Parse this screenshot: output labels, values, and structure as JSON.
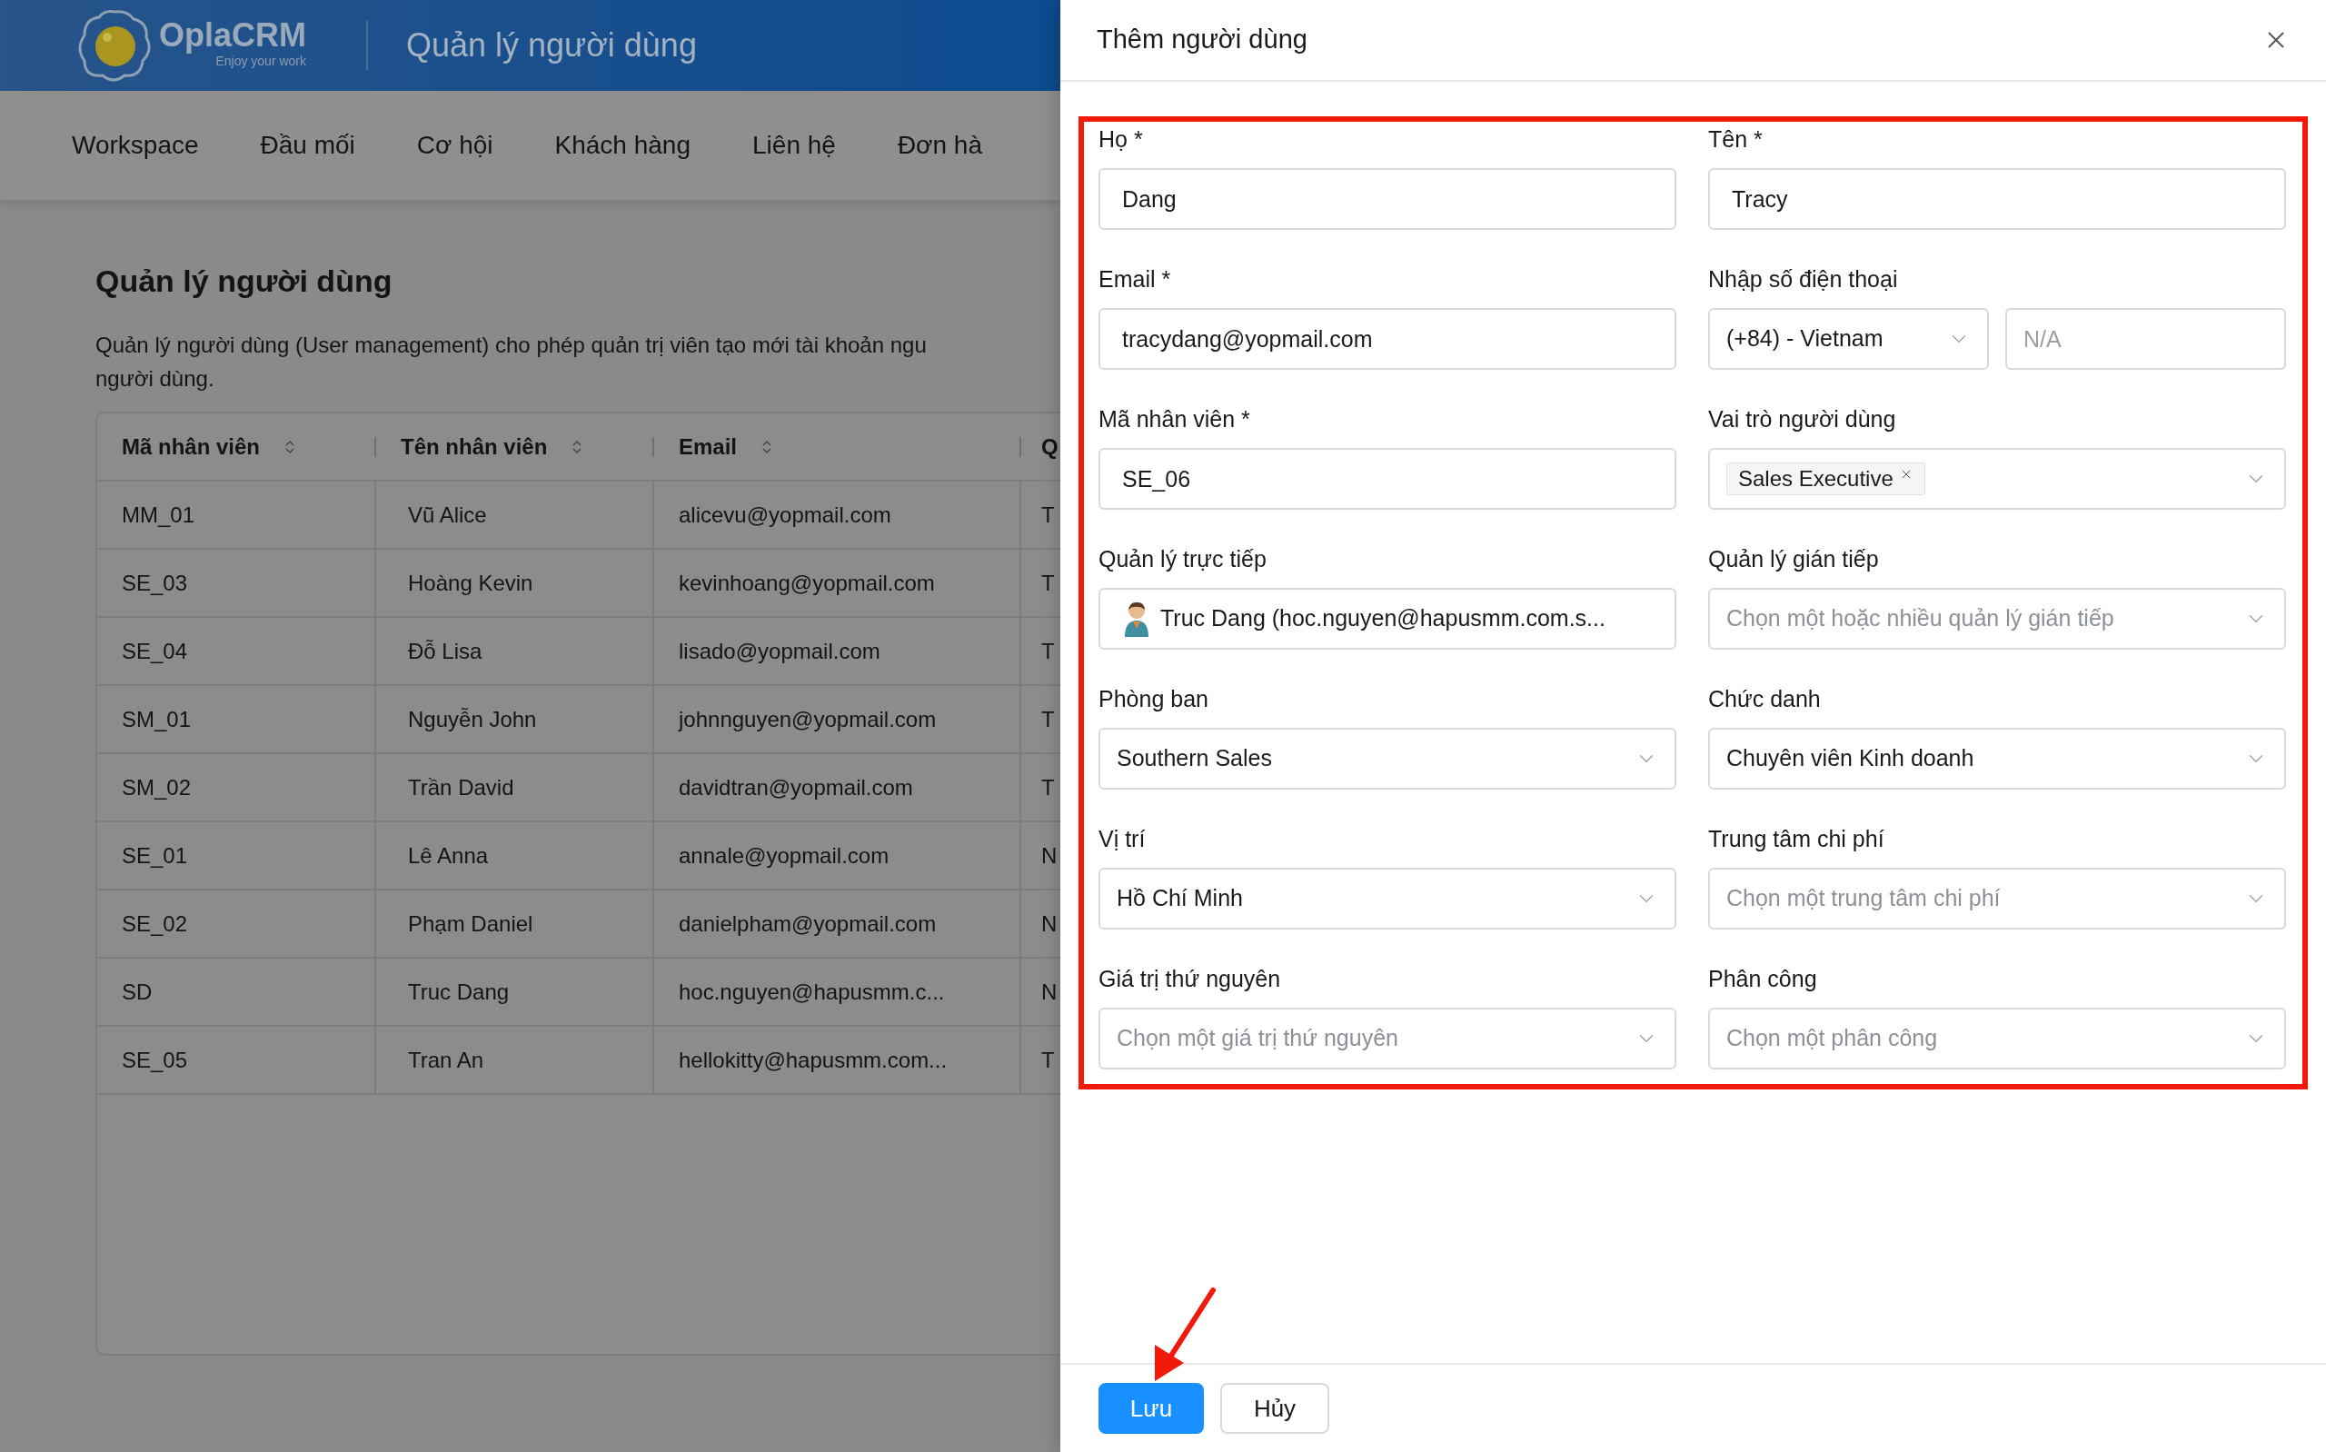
{
  "app": {
    "logo": {
      "name": "OplaCRM",
      "tagline": "Enjoy your work"
    },
    "header_title": "Quản lý người dùng",
    "nav": [
      {
        "label": "Workspace"
      },
      {
        "label": "Đầu mối"
      },
      {
        "label": "Cơ hội"
      },
      {
        "label": "Khách hàng"
      },
      {
        "label": "Liên hệ"
      },
      {
        "label": "Đơn hà"
      }
    ],
    "page_title": "Quản lý người dùng",
    "description": [
      "Quản lý người dùng (User management) cho phép quản trị viên tạo mới tài khoản ngu",
      "người dùng."
    ],
    "table": {
      "columns": [
        {
          "label": "Mã nhân viên",
          "sortable": true
        },
        {
          "label": "Tên nhân viên",
          "sortable": true
        },
        {
          "label": "Email",
          "sortable": true
        },
        {
          "label": "Q"
        }
      ],
      "rows": [
        [
          "MM_01",
          "Vũ Alice",
          "alicevu@yopmail.com",
          "T"
        ],
        [
          "SE_03",
          "Hoàng Kevin",
          "kevinhoang@yopmail.com",
          "T"
        ],
        [
          "SE_04",
          "Đỗ Lisa",
          "lisado@yopmail.com",
          "T"
        ],
        [
          "SM_01",
          "Nguyễn John",
          "johnnguyen@yopmail.com",
          "T"
        ],
        [
          "SM_02",
          "Trần David",
          "davidtran@yopmail.com",
          "T"
        ],
        [
          "SE_01",
          "Lê Anna",
          "annale@yopmail.com",
          "N"
        ],
        [
          "SE_02",
          "Phạm Daniel",
          "danielpham@yopmail.com",
          "N"
        ],
        [
          "SD",
          "Truc Dang",
          "hoc.nguyen@hapusmm.c...",
          "N"
        ],
        [
          "SE_05",
          "Tran An",
          "hellokitty@hapusmm.com...",
          "T"
        ]
      ]
    }
  },
  "drawer": {
    "title": "Thêm người dùng",
    "fields": [
      {
        "kind": "input",
        "label": "Họ *",
        "value": "Dang"
      },
      {
        "kind": "input",
        "label": "Tên *",
        "value": "Tracy"
      },
      {
        "kind": "input",
        "label": "Email *",
        "value": "tracydang@yopmail.com"
      },
      {
        "kind": "phone",
        "label": "Nhập số điện thoại",
        "country": "(+84) - Vietnam",
        "placeholder": "N/A"
      },
      {
        "kind": "input",
        "label": "Mã nhân viên *",
        "value": "SE_06"
      },
      {
        "kind": "tags",
        "label": "Vai trò người dùng",
        "tags": [
          "Sales Executive"
        ]
      },
      {
        "kind": "user",
        "label": "Quản lý trực tiếp",
        "value": "Truc Dang (hoc.nguyen@hapusmm.com.s..."
      },
      {
        "kind": "select",
        "label": "Quản lý gián tiếp",
        "placeholder": "Chọn một hoặc nhiều quản lý gián tiếp"
      },
      {
        "kind": "select",
        "label": "Phòng ban",
        "value": "Southern Sales"
      },
      {
        "kind": "select",
        "label": "Chức danh",
        "value": "Chuyên viên Kinh doanh"
      },
      {
        "kind": "select",
        "label": "Vị trí",
        "value": "Hồ Chí Minh"
      },
      {
        "kind": "select",
        "label": "Trung tâm chi phí",
        "placeholder": "Chọn một trung tâm chi phí"
      },
      {
        "kind": "select",
        "label": "Giá trị thứ nguyên",
        "placeholder": "Chọn một giá trị thứ nguyên"
      },
      {
        "kind": "select",
        "label": "Phân công",
        "placeholder": "Chọn một phân công"
      }
    ],
    "buttons": [
      {
        "label": "Lưu",
        "kind": "primary"
      },
      {
        "label": "Hủy",
        "kind": "default"
      }
    ]
  },
  "annotations": {
    "highlight_box": true,
    "arrow": true
  }
}
